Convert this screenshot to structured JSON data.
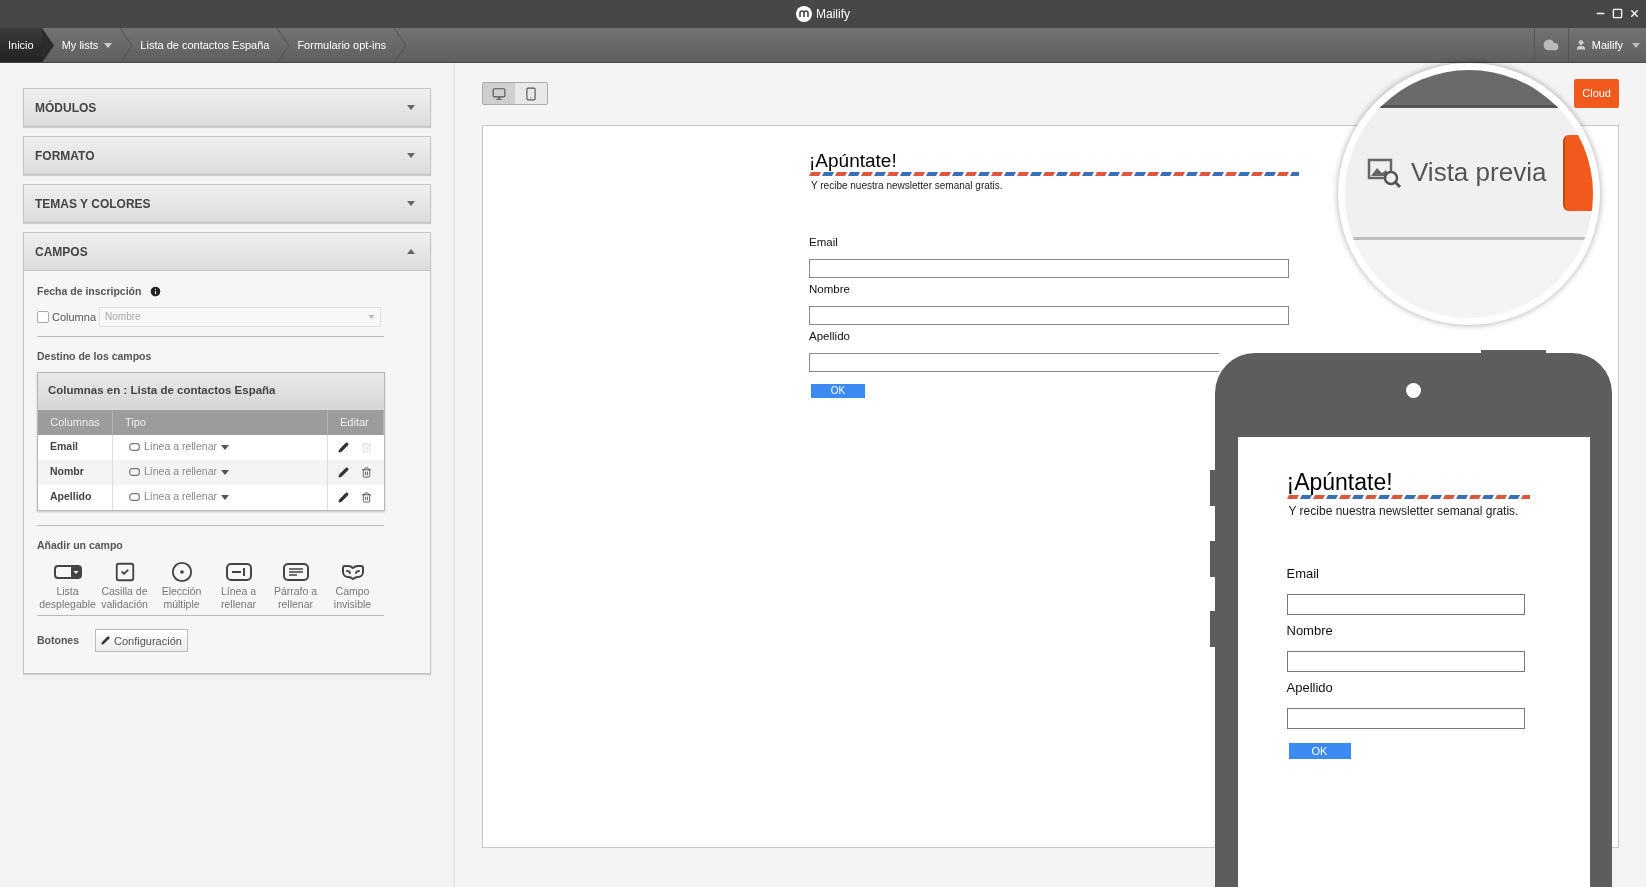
{
  "window": {
    "title": "Mailify"
  },
  "breadcrumbs": [
    {
      "label": "Inicio",
      "selected": true,
      "dropdown": false
    },
    {
      "label": "My lists",
      "selected": false,
      "dropdown": true
    },
    {
      "label": "Lista de contactos España",
      "selected": false,
      "dropdown": false
    },
    {
      "label": "Formulario opt-ins",
      "selected": false,
      "dropdown": false
    }
  ],
  "user_menu": {
    "label": "Mailify"
  },
  "sidebar": {
    "sections": [
      {
        "title": "MÓDULOS",
        "expanded": false
      },
      {
        "title": "FORMATO",
        "expanded": false
      },
      {
        "title": "TEMAS Y COLORES",
        "expanded": false
      },
      {
        "title": "CAMPOS",
        "expanded": true
      }
    ],
    "campos": {
      "signup_date": {
        "label": "Fecha de inscripción",
        "checkbox": {
          "label": "Columna",
          "checked": false
        },
        "select": {
          "placeholder": "Nombre",
          "disabled": true
        }
      },
      "destination": {
        "label": "Destino de los campos",
        "table_title": "Columnas en : Lista de contactos España",
        "columns": [
          "Columnas",
          "Tipo",
          "Editar"
        ],
        "rows": [
          {
            "name": "Email",
            "type": "Línea a rellenar",
            "delete_disabled": true
          },
          {
            "name": "Nombr",
            "type": "Línea a rellenar",
            "delete_disabled": false
          },
          {
            "name": "Apellido",
            "type": "Línea a rellenar",
            "delete_disabled": false
          }
        ]
      },
      "add_field": {
        "label": "Añadir un campo",
        "types": [
          {
            "kind": "dropdown",
            "label": "Lista desplegable"
          },
          {
            "kind": "checkbox",
            "label": "Casilla de validación"
          },
          {
            "kind": "radio",
            "label": "Elección múltiple"
          },
          {
            "kind": "line",
            "label": "Línea a rellenar"
          },
          {
            "kind": "paragraph",
            "label": "Párrafo a rellenar"
          },
          {
            "kind": "hidden",
            "label": "Campo invisible"
          }
        ]
      },
      "buttons": {
        "label": "Botones",
        "config_button": "Configuración"
      }
    }
  },
  "main": {
    "view_toggle": [
      {
        "kind": "desktop",
        "selected": true
      },
      {
        "kind": "mobile",
        "selected": false
      }
    ],
    "cloud_button": "Cloud",
    "form": {
      "title": "¡Apúntate!",
      "subtitle": "Y recibe nuestra newsletter semanal gratis.",
      "fields": [
        {
          "label": "Email"
        },
        {
          "label": "Nombre"
        },
        {
          "label": "Apellido"
        }
      ],
      "submit": "OK"
    },
    "magnifier": {
      "preview_button": "Vista previa"
    },
    "phone_preview": {
      "form": {
        "title": "¡Apúntate!",
        "subtitle": "Y recibe nuestra newsletter semanal gratis.",
        "fields": [
          {
            "label": "Email"
          },
          {
            "label": "Nombre"
          },
          {
            "label": "Apellido"
          }
        ],
        "submit": "OK"
      }
    }
  }
}
